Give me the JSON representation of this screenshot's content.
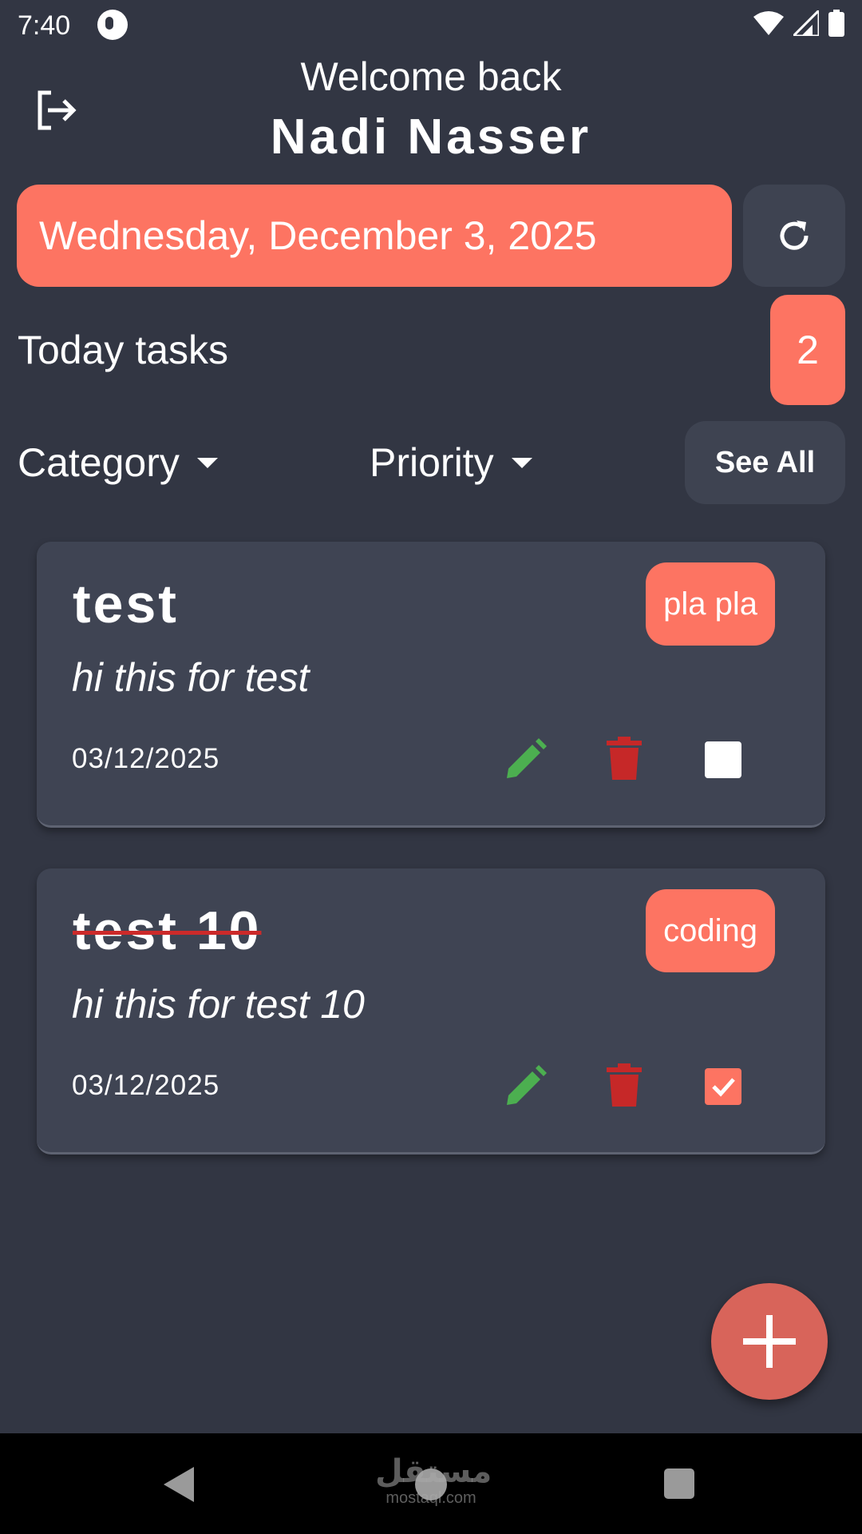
{
  "status_bar": {
    "time": "7:40",
    "icons": [
      "app-notification-icon",
      "wifi-icon",
      "signal-icon",
      "battery-icon"
    ]
  },
  "header": {
    "logout_icon": "logout-icon",
    "greeting": "Welcome back",
    "user_name": "Nadi Nasser"
  },
  "date_bar": {
    "date": "Wednesday, December 3, 2025",
    "refresh_icon": "refresh-icon"
  },
  "today": {
    "label": "Today tasks",
    "count": "2"
  },
  "filters": {
    "category_label": "Category",
    "priority_label": "Priority",
    "see_all_label": "See All"
  },
  "tasks": [
    {
      "title": "test",
      "description": "hi this for test",
      "date": "03/12/2025",
      "category": "pla pla",
      "completed": false
    },
    {
      "title": "test 10",
      "description": "hi this for test 10",
      "date": "03/12/2025",
      "category": "coding",
      "completed": true
    }
  ],
  "fab": {
    "icon": "plus-icon"
  },
  "nav_bar": {
    "icons": [
      "back-icon",
      "home-icon",
      "recents-icon"
    ]
  },
  "watermark": {
    "arabic": "مستقل",
    "latin": "mostaql.com"
  },
  "colors": {
    "background": "#323643",
    "card": "#3f4453",
    "accent": "#fd7462",
    "fab": "#d8645a",
    "edit": "#4caf50",
    "delete": "#c62828"
  }
}
